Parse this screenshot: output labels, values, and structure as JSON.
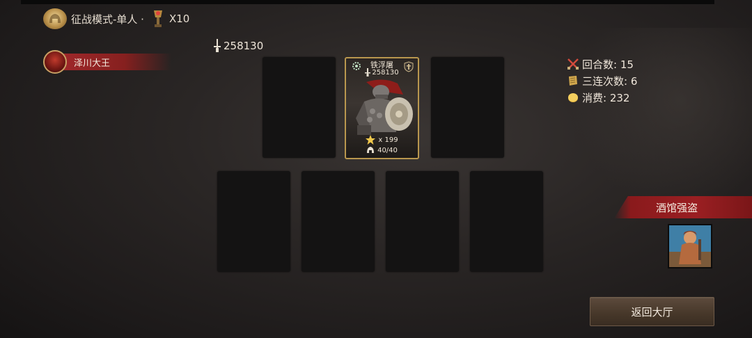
{
  "header": {
    "mode_text": "征战模式-单人 ·",
    "multiplier": "X10",
    "helmet_icon": "golden-helmet-icon",
    "trophy_icon": "torch-trophy-icon"
  },
  "player": {
    "name": "泽川大王",
    "avatar_icon": "demon-avatar-icon"
  },
  "total_power": "258130",
  "hero_card": {
    "name": "铁浮屠",
    "power": "258130",
    "stars": "x 199",
    "troops": "40/40",
    "class_icon": "gear-class-icon",
    "shield_icon": "shield-icon"
  },
  "stats": {
    "rounds": "回合数: 15",
    "triple": "三连次数: 6",
    "cost": "消费: 232"
  },
  "enemy": {
    "name": "酒馆强盗"
  },
  "buttons": {
    "return": "返回大厅"
  },
  "colors": {
    "accent_gold": "#b9974e",
    "banner_red": "#9a1f22",
    "button_brown": "#463729"
  }
}
